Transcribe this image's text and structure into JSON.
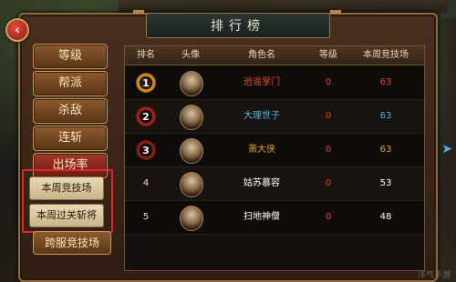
{
  "panel": {
    "title": "排行榜"
  },
  "menu": {
    "items": [
      {
        "label": "等级"
      },
      {
        "label": "帮派"
      },
      {
        "label": "杀敌"
      },
      {
        "label": "连斩"
      },
      {
        "label": "出场率"
      }
    ],
    "sub_items": [
      {
        "label": "本周竞技场"
      },
      {
        "label": "本周过关斩将"
      }
    ],
    "bottom": {
      "label": "跨服竞技场"
    }
  },
  "table": {
    "headers": [
      "排名",
      "头像",
      "角色名",
      "等级",
      "本周竞技场"
    ],
    "rows": [
      {
        "rank": "1",
        "name": "逍遥掌门",
        "level": "0",
        "score": "63",
        "color": "#e0452e"
      },
      {
        "rank": "2",
        "name": "大理世子",
        "level": "0",
        "score": "63",
        "color": "#49b7e8"
      },
      {
        "rank": "3",
        "name": "萧大侠",
        "level": "0",
        "score": "63",
        "color": "#d8a13a"
      },
      {
        "rank": "4",
        "name": "姑苏慕容",
        "level": "0",
        "score": "53",
        "color": "#ffffff"
      },
      {
        "rank": "5",
        "name": "扫地神僧",
        "level": "0",
        "score": "48",
        "color": "#ffffff"
      }
    ]
  },
  "colors": {
    "level": "#e0452e",
    "score": [
      "#e0452e",
      "#49b7e8",
      "#d8a13a",
      "#ffffff",
      "#ffffff"
    ],
    "badge": [
      "#e8a820",
      "#c02a1c",
      "#9a2a1c"
    ]
  },
  "watermark": "洋气手游"
}
